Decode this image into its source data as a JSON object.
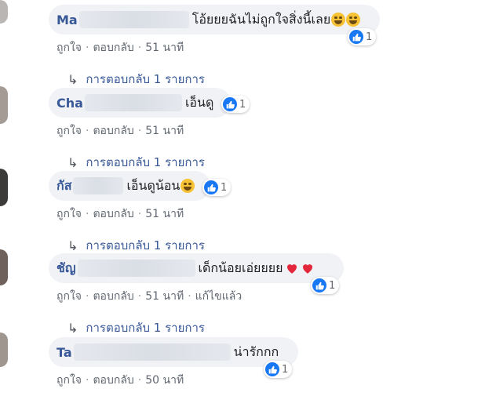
{
  "common": {
    "like_label": "ถูกใจ",
    "reply_label": "ตอบกลับ",
    "dot": "·",
    "replies_label": "การตอบกลับ 1 รายการ"
  },
  "comments": [
    {
      "name_prefix": "Ma",
      "text": "โอ้ยยยฉันไม่ถูกใจสิ่งนี้เลย",
      "emoji": [
        "rofl-emoji",
        "rofl-emoji"
      ],
      "reaction_count": "1",
      "time": "51 นาที"
    },
    {
      "name_prefix": "Cha",
      "text": "เอ็นดู",
      "emoji": [],
      "reaction_count": "1",
      "time": "51 นาที"
    },
    {
      "name_prefix": "กัส",
      "text": "เอ็นดูน้อน",
      "emoji": [
        "grin-emoji"
      ],
      "reaction_count": "1",
      "time": "51 นาที"
    },
    {
      "name_prefix": "ชัญ",
      "text": "เด็กน้อยเอ่ยยยย",
      "emoji": [
        "red-heart",
        "red-heart"
      ],
      "reaction_count": "1",
      "time": "51 นาที",
      "edited": "แก้ไขแล้ว"
    },
    {
      "name_prefix": "Ta",
      "text": "น่ารักกก",
      "emoji": [],
      "reaction_count": "1",
      "time": "50 นาที"
    }
  ],
  "colors": {
    "name": "#385898",
    "like_blue": "#1877f2",
    "bubble": "#f0f2f5"
  }
}
